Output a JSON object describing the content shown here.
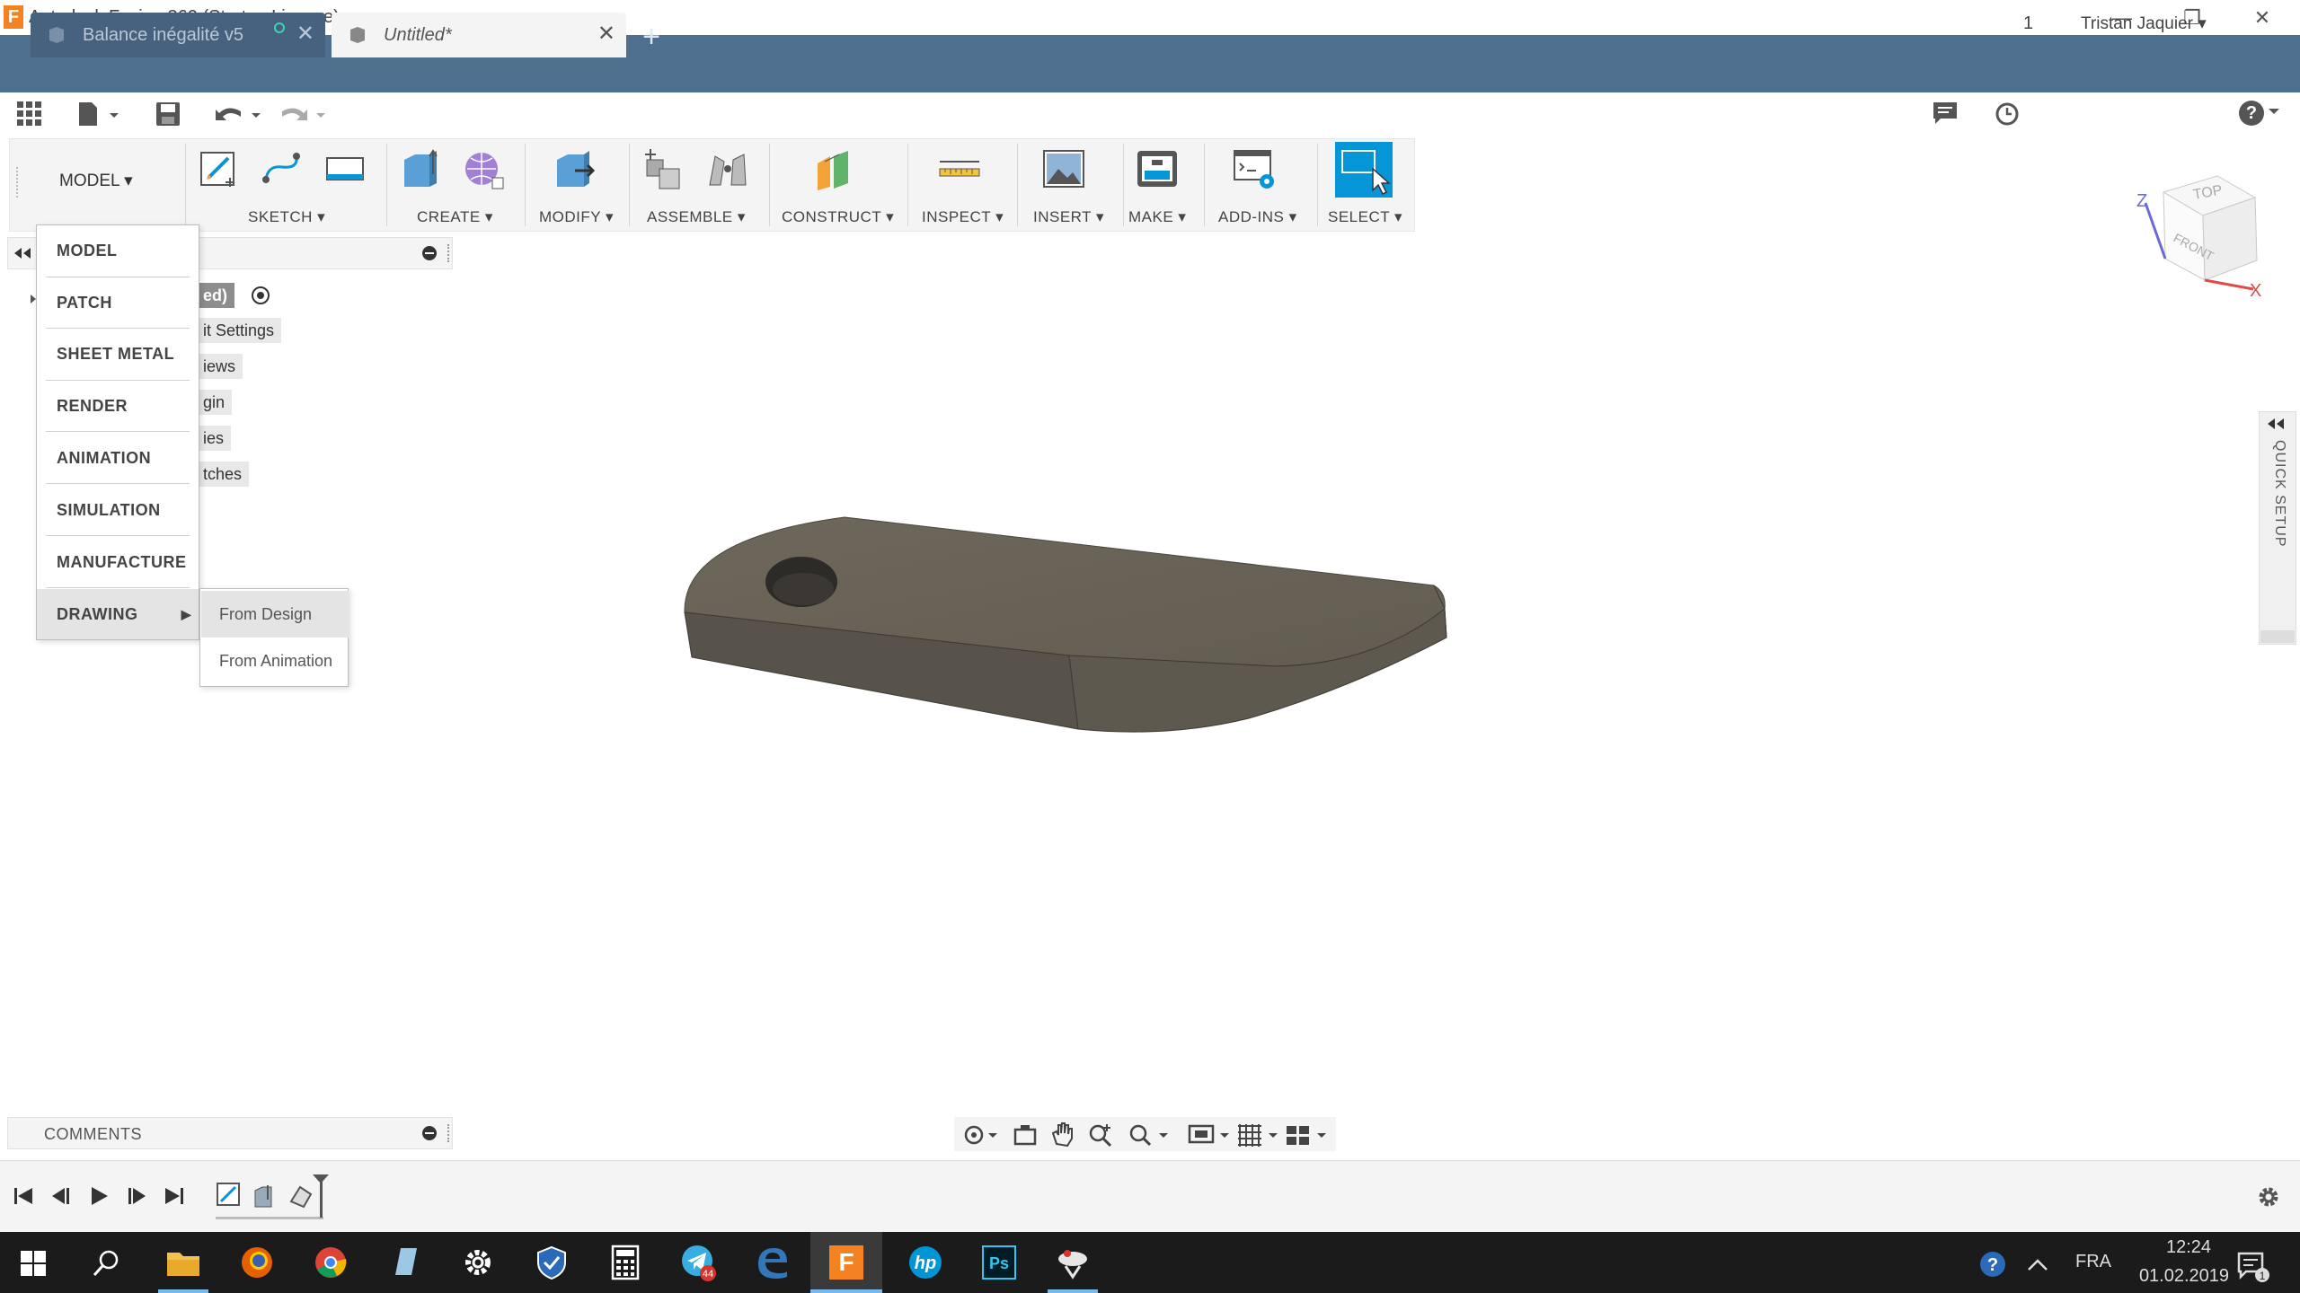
{
  "window": {
    "title": "Autodesk Fusion 360 (Startup License)",
    "logo_letter": "F",
    "minimize": "—",
    "restore": "❐",
    "close": "✕"
  },
  "tabs": [
    {
      "label": "Balance inégalité v5",
      "close": "✕"
    },
    {
      "label": "Untitled*",
      "close": "✕"
    }
  ],
  "new_tab": "+",
  "quickbar": {
    "jobs_count": "1",
    "user": "Tristan Jaquier ▾",
    "help": "?"
  },
  "ribbon": {
    "workspace": "MODEL ▾",
    "groups": [
      {
        "label": "SKETCH ▾"
      },
      {
        "label": "CREATE ▾"
      },
      {
        "label": "MODIFY ▾"
      },
      {
        "label": "ASSEMBLE ▾"
      },
      {
        "label": "CONSTRUCT ▾"
      },
      {
        "label": "INSPECT ▾"
      },
      {
        "label": "INSERT ▾"
      },
      {
        "label": "MAKE ▾"
      },
      {
        "label": "ADD-INS ▾"
      },
      {
        "label": "SELECT ▾"
      }
    ]
  },
  "browser": {
    "nodes": [
      "ed)",
      "it Settings",
      "iews",
      "gin",
      "ies",
      "tches"
    ]
  },
  "workspace_menu": {
    "items": [
      "MODEL",
      "PATCH",
      "SHEET METAL",
      "RENDER",
      "ANIMATION",
      "SIMULATION",
      "MANUFACTURE",
      "DRAWING"
    ],
    "drawing_arrow": "▶",
    "submenu": [
      "From Design",
      "From Animation"
    ]
  },
  "viewcube": {
    "top": "TOP",
    "front": "FRONT",
    "z": "Z",
    "x": "X"
  },
  "quick_setup": "QUICK SETUP",
  "comments": "COMMENTS",
  "taskbar": {
    "language": "FRA",
    "time": "12:24",
    "date": "01.02.2019",
    "telegram_badge": "44",
    "notif_count": "1"
  },
  "colors": {
    "tabbar": "#4f6f8f",
    "select_blue": "#0696d7",
    "model": "#6b6559",
    "taskbar": "#1b1b1b"
  }
}
